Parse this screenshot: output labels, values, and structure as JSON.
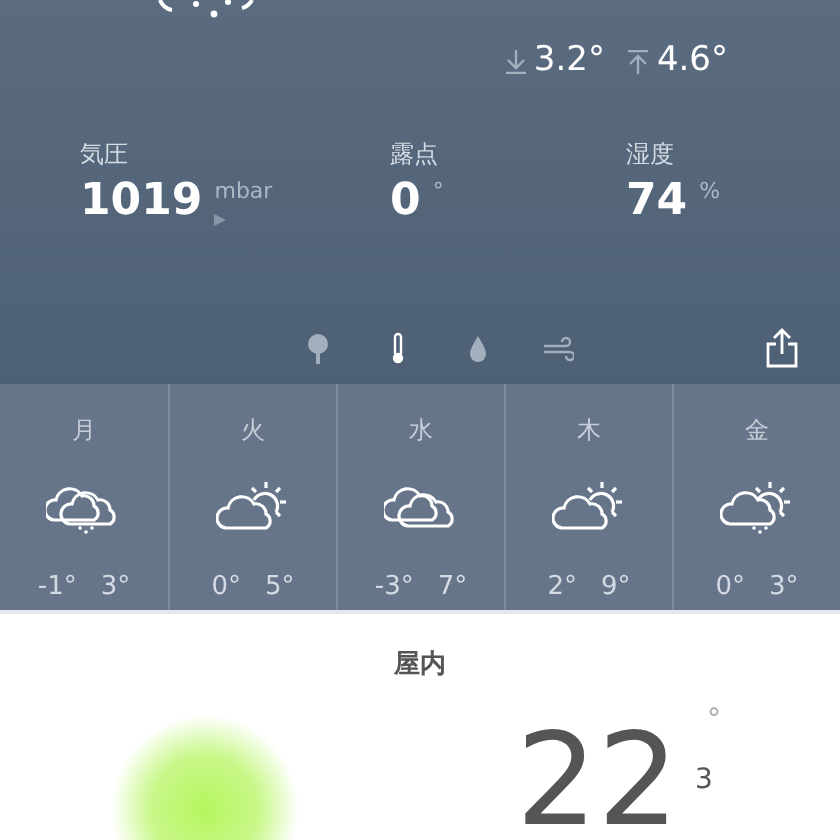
{
  "current": {
    "low": "3.2",
    "high": "4.6",
    "degree": "°"
  },
  "stats": [
    {
      "label": "気圧",
      "value": "1019",
      "unit": "mbar",
      "has_arrow": true
    },
    {
      "label": "露点",
      "value": "0",
      "unit": "°",
      "has_arrow": false
    },
    {
      "label": "湿度",
      "value": "74",
      "unit": "%",
      "has_arrow": false
    }
  ],
  "layers": [
    {
      "kind": "tree",
      "selected": false
    },
    {
      "kind": "thermometer",
      "selected": true
    },
    {
      "kind": "drop",
      "selected": false
    },
    {
      "kind": "wind",
      "selected": false
    }
  ],
  "forecast": [
    {
      "day": "月",
      "kind": "cloud-snow",
      "low": "-1°",
      "high": "3°"
    },
    {
      "day": "火",
      "kind": "partly-sunny",
      "low": "0°",
      "high": "5°"
    },
    {
      "day": "水",
      "kind": "cloudy",
      "low": "-3°",
      "high": "7°"
    },
    {
      "day": "木",
      "kind": "partly-sunny",
      "low": "2°",
      "high": "9°"
    },
    {
      "day": "金",
      "kind": "partly-sunny-snow",
      "low": "0°",
      "high": "3°"
    }
  ],
  "indoor": {
    "title": "屋内",
    "value": "22",
    "decimal": "3",
    "degree": "°"
  }
}
